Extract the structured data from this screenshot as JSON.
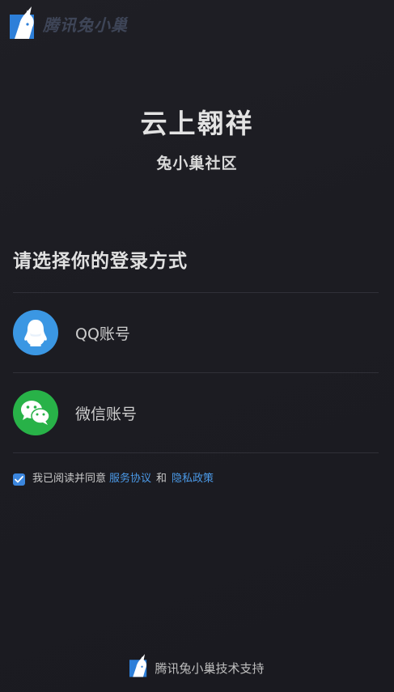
{
  "brand": {
    "logo_icon": "rabbit-flag-logo-icon",
    "name": "腾讯兔小巢"
  },
  "hero": {
    "title": "云上翱祥",
    "subtitle": "兔小巢社区"
  },
  "login": {
    "heading": "请选择你的登录方式",
    "options": [
      {
        "icon": "qq-penguin-icon",
        "label": "QQ账号",
        "color": "#3b97e3"
      },
      {
        "icon": "wechat-icon",
        "label": "微信账号",
        "color": "#28b248"
      }
    ]
  },
  "agreement": {
    "checked": true,
    "prefix": "我已阅读并同意",
    "service_link": "服务协议",
    "and_text": "和",
    "privacy_link": "隐私政策",
    "link_color": "#4b9ae8"
  },
  "footer": {
    "icon": "rabbit-flag-logo-icon",
    "text": "腾讯兔小巢技术支持"
  }
}
